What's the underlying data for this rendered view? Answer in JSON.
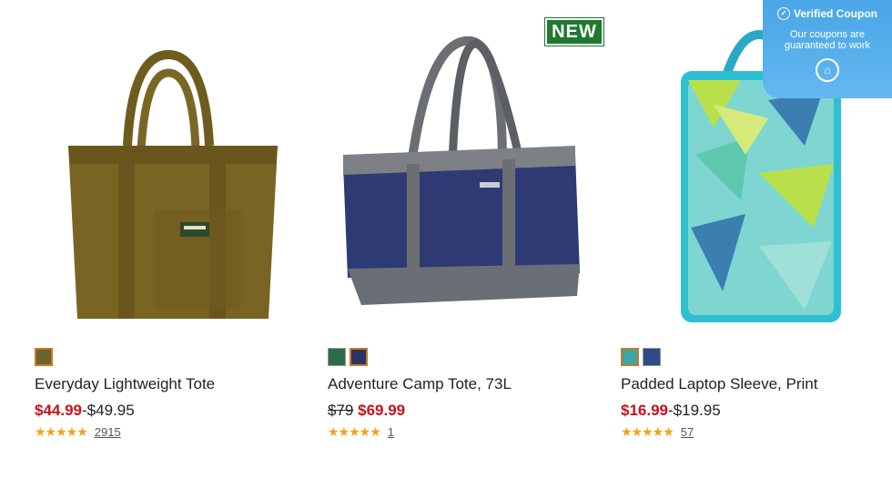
{
  "products": [
    {
      "name": "Everyday Lightweight Tote",
      "price_sale": "$44.99",
      "price_rest": "-$49.95",
      "rating_stars": 4.5,
      "stars_text": "★★★★★",
      "review_count": "2915",
      "swatch_colors": [
        "#6b6330"
      ],
      "selected_swatch": 0
    },
    {
      "name": "Adventure Camp Tote, 73L",
      "price_original": "$79",
      "price_sale": "$69.99",
      "rating_stars": 5,
      "stars_text": "★★★★★",
      "review_count": "1",
      "badge": "NEW",
      "swatch_colors": [
        "#2f6b4a",
        "#2b3560"
      ],
      "selected_swatch": 1
    },
    {
      "name": "Padded Laptop Sleeve, Print",
      "price_sale": "$16.99",
      "price_rest": "-$19.95",
      "rating_stars": 4.5,
      "stars_text": "★★★★★",
      "review_count": "57",
      "swatch_colors": [
        "#3aa6a6",
        "#2e4a8a"
      ],
      "selected_swatch": 0
    }
  ],
  "coupon": {
    "title": "Verified Coupon",
    "subtitle": "Our coupons are guaranteed to work",
    "icon": "graduation-cap-icon"
  },
  "colors": {
    "sale_red": "#c4121b",
    "star_gold": "#f0a31c",
    "badge_green": "#1f7a2f",
    "coupon_blue": "#4aa6e8"
  }
}
